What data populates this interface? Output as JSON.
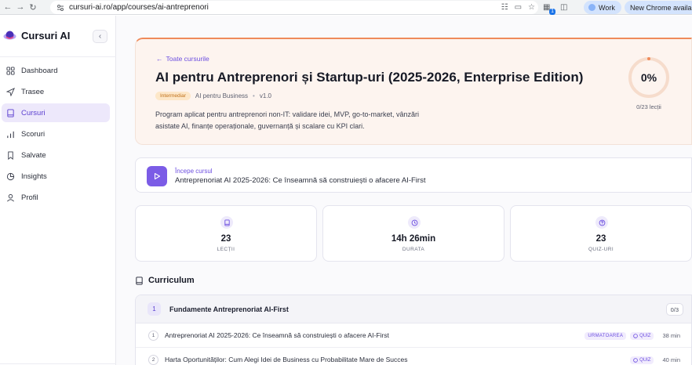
{
  "browser": {
    "url": "cursuri-ai.ro/app/courses/ai-antreprenori",
    "profile_label": "Work",
    "update_label": "New Chrome availab",
    "extension_badge": "1"
  },
  "sidebar": {
    "brand": "Cursuri AI",
    "collapse_symbol": "‹",
    "items": [
      {
        "label": "Dashboard",
        "icon": "grid-icon"
      },
      {
        "label": "Trasee",
        "icon": "send-icon"
      },
      {
        "label": "Cursuri",
        "icon": "book-icon",
        "active": true
      },
      {
        "label": "Scoruri",
        "icon": "bar-chart-icon"
      },
      {
        "label": "Salvate",
        "icon": "bookmark-icon"
      },
      {
        "label": "Insights",
        "icon": "pie-icon"
      },
      {
        "label": "Profil",
        "icon": "user-icon"
      }
    ]
  },
  "course": {
    "back_label": "Toate cursurile",
    "title": "AI pentru Antreprenori și Startup-uri (2025-2026, Enterprise Edition)",
    "level": "Intermediar",
    "category": "AI pentru Business",
    "version": "v1.0",
    "description": "Program aplicat pentru antreprenori non-IT: validare idei, MVP, go-to-market, vânzări asistate AI, finanțe operaționale, guvernanță și scalare cu KPI clari.",
    "progress_label": "0%",
    "progress_fraction": 0,
    "lessons_progress": "0/23 lecții"
  },
  "start": {
    "label": "Începe cursul",
    "lesson": "Antreprenoriat AI 2025-2026: Ce înseamnă să construiești o afacere AI-First"
  },
  "stats": [
    {
      "value": "23",
      "label": "LECȚII",
      "icon": "book-icon"
    },
    {
      "value": "14h 26min",
      "label": "DURATA",
      "icon": "clock-icon"
    },
    {
      "value": "23",
      "label": "QUIZ-URI",
      "icon": "help-circle-icon"
    }
  ],
  "curriculum": {
    "title": "Curriculum",
    "module": {
      "number": "1",
      "title": "Fundamente Antreprenoriat AI-First",
      "count": "0/3"
    },
    "lessons": [
      {
        "number": "1",
        "title": "Antreprenoriat AI 2025-2026: Ce înseamnă să construiești o afacere AI-First",
        "next_badge": "URMATOAREA",
        "quiz": "QUIZ",
        "duration": "38 min"
      },
      {
        "number": "2",
        "title": "Harta Oportunităților: Cum Alegi Idei de Business cu Probabilitate Mare de Succes",
        "next_badge": "",
        "quiz": "QUIZ",
        "duration": "40 min"
      }
    ]
  },
  "colors": {
    "accent": "#6c4ee0",
    "hero_border": "#ef8a5a",
    "hero_bg": "#fdf4ef",
    "active_nav_bg": "#ede8fb"
  }
}
